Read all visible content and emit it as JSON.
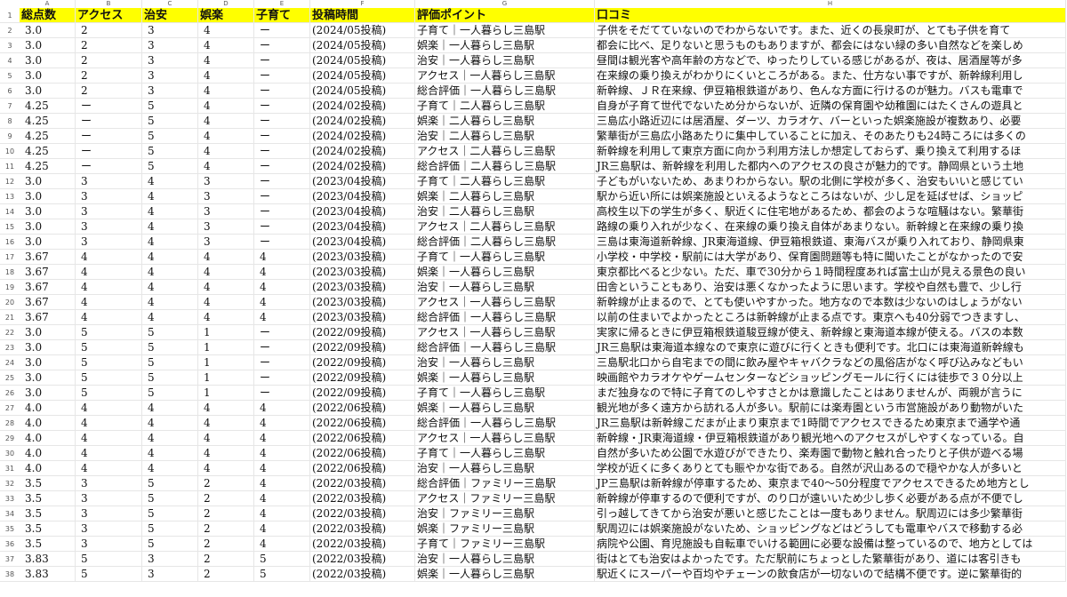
{
  "columns": [
    "A",
    "B",
    "C",
    "D",
    "E",
    "F",
    "G",
    "H"
  ],
  "headers": [
    "総点数",
    "アクセス",
    "治安",
    "娯楽",
    "子育て",
    "投稿時間",
    "評価ポイント",
    "口コミ"
  ],
  "rows": [
    [
      "3.0",
      "2",
      "3",
      "4",
      "ー",
      "(2024/05投稿)",
      "子育て｜一人暮らし三島駅",
      "子供をそだてていないのでわからないです。また、近くの長泉町が、とても子供を育て"
    ],
    [
      "3.0",
      "2",
      "3",
      "4",
      "ー",
      "(2024/05投稿)",
      "娯楽｜一人暮らし三島駅",
      "都会に比べ、足りないと思うものもありますが、都会にはない緑の多い自然などを楽しめ"
    ],
    [
      "3.0",
      "2",
      "3",
      "4",
      "ー",
      "(2024/05投稿)",
      "治安｜一人暮らし三島駅",
      "昼間は観光客や高年齢の方などで、ゆったりしている感じがあるが、夜は、居酒屋等が多"
    ],
    [
      "3.0",
      "2",
      "3",
      "4",
      "ー",
      "(2024/05投稿)",
      "アクセス｜一人暮らし三島駅",
      "在来線の乗り換えがわかりにくいところがある。また、仕方ない事ですが、新幹線利用し"
    ],
    [
      "3.0",
      "2",
      "3",
      "4",
      "ー",
      "(2024/05投稿)",
      "総合評価｜一人暮らし三島駅",
      "新幹線、ＪＲ在来線、伊豆箱根鉄道があり、色んな方面に行けるのが魅力。バスも電車で"
    ],
    [
      "4.25",
      "ー",
      "5",
      "4",
      "ー",
      "(2024/02投稿)",
      "子育て｜二人暮らし三島駅",
      "自身が子育て世代でないため分からないが、近隣の保育園や幼稚園にはたくさんの遊具と"
    ],
    [
      "4.25",
      "ー",
      "5",
      "4",
      "ー",
      "(2024/02投稿)",
      "娯楽｜二人暮らし三島駅",
      "三島広小路近辺には居酒屋、ダーツ、カラオケ、バーといった娯楽施設が複数あり、必要"
    ],
    [
      "4.25",
      "ー",
      "5",
      "4",
      "ー",
      "(2024/02投稿)",
      "治安｜二人暮らし三島駅",
      "繁華街が三島広小路あたりに集中していることに加え、そのあたりも24時ころには多くの"
    ],
    [
      "4.25",
      "ー",
      "5",
      "4",
      "ー",
      "(2024/02投稿)",
      "アクセス｜二人暮らし三島駅",
      "新幹線を利用して東京方面に向かう利用方法しか想定しておらず、乗り換えて利用するほ"
    ],
    [
      "4.25",
      "ー",
      "5",
      "4",
      "ー",
      "(2024/02投稿)",
      "総合評価｜二人暮らし三島駅",
      "JR三島駅は、新幹線を利用した都内へのアクセスの良さが魅力的です。静岡県という土地"
    ],
    [
      "3.0",
      "3",
      "4",
      "3",
      "ー",
      "(2023/04投稿)",
      "子育て｜二人暮らし三島駅",
      "子どもがいないため、あまりわからない。駅の北側に学校が多く、治安もいいと感じてい"
    ],
    [
      "3.0",
      "3",
      "4",
      "3",
      "ー",
      "(2023/04投稿)",
      "娯楽｜二人暮らし三島駅",
      "駅から近い所には娯楽施設といえるようなところはないが、少し足を延ばせば、ショッピ"
    ],
    [
      "3.0",
      "3",
      "4",
      "3",
      "ー",
      "(2023/04投稿)",
      "治安｜二人暮らし三島駅",
      "高校生以下の学生が多く、駅近くに住宅地があるため、都会のような喧騒はない。繁華街"
    ],
    [
      "3.0",
      "3",
      "4",
      "3",
      "ー",
      "(2023/04投稿)",
      "アクセス｜二人暮らし三島駅",
      "路線の乗り入れが少なく、在来線の乗り換え自体があまりない。新幹線と在来線の乗り換"
    ],
    [
      "3.0",
      "3",
      "4",
      "3",
      "ー",
      "(2023/04投稿)",
      "総合評価｜二人暮らし三島駅",
      "三島は東海道新幹線、JR東海道線、伊豆箱根鉄道、東海バスが乗り入れており、静岡県東"
    ],
    [
      "3.67",
      "4",
      "4",
      "4",
      "4",
      "(2023/03投稿)",
      "子育て｜一人暮らし三島駅",
      "小学校・中学校・駅前には大学があり、保育園問題等も特に聞いたことがなかったので安"
    ],
    [
      "3.67",
      "4",
      "4",
      "4",
      "4",
      "(2023/03投稿)",
      "娯楽｜一人暮らし三島駅",
      "東京都比べると少ない。ただ、車で30分から１時間程度あれば富士山が見える景色の良い"
    ],
    [
      "3.67",
      "4",
      "4",
      "4",
      "4",
      "(2023/03投稿)",
      "治安｜一人暮らし三島駅",
      "田舎ということもあり、治安は悪くなかったように思います。学校や自然も豊で、少し行"
    ],
    [
      "3.67",
      "4",
      "4",
      "4",
      "4",
      "(2023/03投稿)",
      "アクセス｜一人暮らし三島駅",
      "新幹線が止まるので、とても使いやすかった。地方なので本数は少ないのはしょうがない"
    ],
    [
      "3.67",
      "4",
      "4",
      "4",
      "4",
      "(2023/03投稿)",
      "総合評価｜一人暮らし三島駅",
      "以前の住まいでよかったところは新幹線が止まる点です。東京へも40分弱でつきますし、"
    ],
    [
      "3.0",
      "5",
      "5",
      "1",
      "ー",
      "(2022/09投稿)",
      "アクセス｜一人暮らし三島駅",
      "実家に帰るときに伊豆箱根鉄道駿豆線が使え、新幹線と東海道本線が使える。バスの本数"
    ],
    [
      "3.0",
      "5",
      "5",
      "1",
      "ー",
      "(2022/09投稿)",
      "総合評価｜一人暮らし三島駅",
      "JR三島駅は東海道本線なので東京に遊びに行くときも便利です。北口には東海道新幹線も"
    ],
    [
      "3.0",
      "5",
      "5",
      "1",
      "ー",
      "(2022/09投稿)",
      "治安｜一人暮らし三島駅",
      "三島駅北口から自宅までの間に飲み屋やキャバクラなどの風俗店がなく呼び込みなどもい"
    ],
    [
      "3.0",
      "5",
      "5",
      "1",
      "ー",
      "(2022/09投稿)",
      "娯楽｜一人暮らし三島駅",
      "映画館やカラオケやゲームセンターなどショッピングモールに行くには徒歩で３０分以上"
    ],
    [
      "3.0",
      "5",
      "5",
      "1",
      "ー",
      "(2022/09投稿)",
      "子育て｜一人暮らし三島駅",
      "まだ独身なので特に子育てのしやすさとかは意識したことはありませんが、両親が言うに"
    ],
    [
      "4.0",
      "4",
      "4",
      "4",
      "4",
      "(2022/06投稿)",
      "娯楽｜一人暮らし三島駅",
      "観光地が多く遠方から訪れる人が多い。駅前には楽寿園という市営施設があり動物がいた"
    ],
    [
      "4.0",
      "4",
      "4",
      "4",
      "4",
      "(2022/06投稿)",
      "総合評価｜一人暮らし三島駅",
      "JR三島駅は新幹線こだまが止まり東京まで1時間でアクセスできるため東京まで通学や通"
    ],
    [
      "4.0",
      "4",
      "4",
      "4",
      "4",
      "(2022/06投稿)",
      "アクセス｜一人暮らし三島駅",
      "新幹線・JR東海道線・伊豆箱根鉄道があり観光地へのアクセスがしやすくなっている。自"
    ],
    [
      "4.0",
      "4",
      "4",
      "4",
      "4",
      "(2022/06投稿)",
      "子育て｜一人暮らし三島駅",
      "自然が多いため公園で水遊びができたり、楽寿園で動物と触れ合ったりと子供が遊べる場"
    ],
    [
      "4.0",
      "4",
      "4",
      "4",
      "4",
      "(2022/06投稿)",
      "治安｜一人暮らし三島駅",
      "学校が近くに多くありとても賑やかな街である。自然が沢山あるので穏やかな人が多いと"
    ],
    [
      "3.5",
      "3",
      "5",
      "2",
      "4",
      "(2022/03投稿)",
      "総合評価｜ファミリー三島駅",
      "JP三島駅は新幹線が停車するため、東京まで40～50分程度でアクセスできるため地方とし"
    ],
    [
      "3.5",
      "3",
      "5",
      "2",
      "4",
      "(2022/03投稿)",
      "アクセス｜ファミリー三島駅",
      "新幹線が停車するので便利ですが、のり口が遠いいため少し歩く必要がある点が不便でし"
    ],
    [
      "3.5",
      "3",
      "5",
      "2",
      "4",
      "(2022/03投稿)",
      "治安｜ファミリー三島駅",
      "引っ越してきてから治安が悪いと感じたことは一度もありません。駅周辺には多少繁華街"
    ],
    [
      "3.5",
      "3",
      "5",
      "2",
      "4",
      "(2022/03投稿)",
      "娯楽｜ファミリー三島駅",
      "駅周辺には娯楽施設がないため、ショッピングなどはどうしても電車やバスで移動する必"
    ],
    [
      "3.5",
      "3",
      "5",
      "2",
      "4",
      "(2022/03投稿)",
      "子育て｜ファミリー三島駅",
      "病院や公園、育児施設も自転車でいける範囲に必要な設備は整っているので、地方としては"
    ],
    [
      "3.83",
      "5",
      "3",
      "2",
      "5",
      "(2022/03投稿)",
      "治安｜一人暮らし三島駅",
      "街はとても治安はよかったです。ただ駅前にちょっとした繁華街があり、道には客引きも"
    ],
    [
      "3.83",
      "5",
      "3",
      "2",
      "5",
      "(2022/03投稿)",
      "娯楽｜一人暮らし三島駅",
      "駅近くにスーパーや百均やチェーンの飲食店が一切ないので結構不便です。逆に繁華街的"
    ]
  ]
}
